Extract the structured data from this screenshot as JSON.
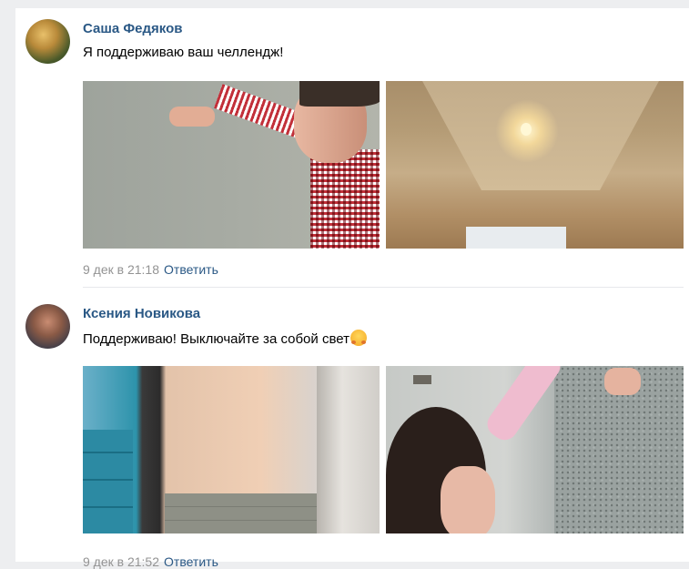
{
  "comments": [
    {
      "author": "Саша Федяков",
      "text": "Я поддерживаю ваш челлендж!",
      "date": "9 дек в 21:18",
      "reply_label": "Ответить"
    },
    {
      "author": "Ксения Новикова",
      "text": "Поддерживаю! Выключайте за собой свет",
      "emoji": "hugging-face-icon",
      "date": "9 дек в 21:52",
      "reply_label": "Ответить"
    }
  ],
  "colors": {
    "link": "#2a5885",
    "meta": "#939393",
    "background": "#edeef0"
  }
}
